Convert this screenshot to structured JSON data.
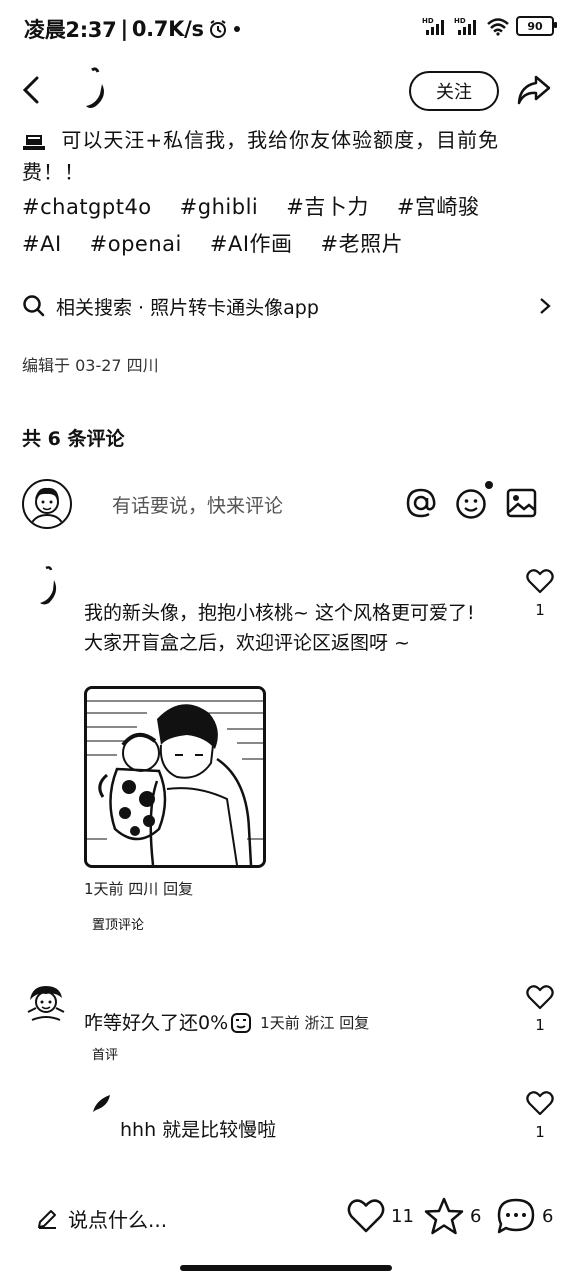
{
  "status_bar": {
    "time": "凌晨2:37",
    "network_speed": "0.7K/s",
    "battery": "90",
    "signal_label": "HD"
  },
  "header": {
    "follow_label": "关注"
  },
  "post": {
    "description": "可以天汪+私信我，我给你友体验额度，目前免费！！",
    "hashtags": [
      "#chatgpt4o",
      "#ghibli",
      "#吉卜力",
      "#宫崎骏",
      "#AI",
      "#openai",
      "#AI作画",
      "#老照片"
    ],
    "related_search": "相关搜索 · 照片转卡通头像app",
    "edit_info": "编辑于 03-27 四川"
  },
  "comments_section": {
    "count_label": "共 6 条评论",
    "input_placeholder": "有话要说，快来评论"
  },
  "comments": [
    {
      "text_line1": "我的新头像，抱抱小核桃~ 这个风格更可爱了!",
      "text_line2": "大家开盲盒之后，欢迎评论区返图呀 ~",
      "meta": "1天前 四川 回复",
      "tag": "置顶评论",
      "likes": "1"
    },
    {
      "text": "咋等好久了还0%",
      "meta": "1天前 浙江 回复",
      "tag": "首评",
      "likes": "1"
    },
    {
      "text": "hhh 就是比较慢啦",
      "likes": "1"
    }
  ],
  "bottom_bar": {
    "input_placeholder": "说点什么...",
    "likes": "11",
    "stars": "6",
    "comments": "6"
  }
}
